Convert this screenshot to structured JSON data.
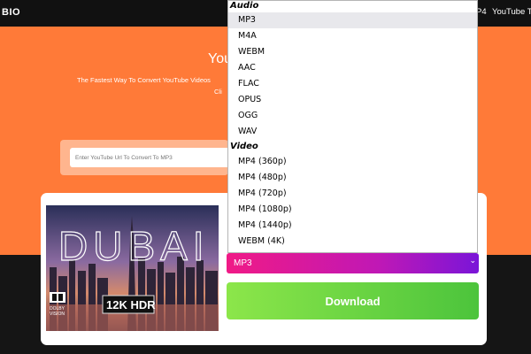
{
  "navbar": {
    "logo": "BIO",
    "links": [
      "P4",
      "YouTube To"
    ]
  },
  "hero": {
    "title": "You",
    "subtitle": "The Fastest Way To Convert YouTube Videos",
    "subtitle2": "Cli"
  },
  "url_input": {
    "placeholder": "Enter YouTube Url To Convert To MP3"
  },
  "thumbnail": {
    "title_text": "DUBAI",
    "badge_text": "12K HDR",
    "brand_line1": "DOLBY",
    "brand_line2": "VISION"
  },
  "format": {
    "selected": "MP3",
    "audio_label": "Audio",
    "audio_options": [
      "MP3",
      "M4A",
      "WEBM",
      "AAC",
      "FLAC",
      "OPUS",
      "OGG",
      "WAV"
    ],
    "video_label": "Video",
    "video_options": [
      "MP4 (360p)",
      "MP4 (480p)",
      "MP4 (720p)",
      "MP4 (1080p)",
      "MP4 (1440p)",
      "WEBM (4K)"
    ],
    "chevron_icon": "chevron-down-icon"
  },
  "download": {
    "label": "Download"
  },
  "colors": {
    "hero": "#ff7a38",
    "accent_gradient_start": "#f01a86",
    "accent_gradient_end": "#7a15d8",
    "download_start": "#8ce64a",
    "download_end": "#4cc43c"
  }
}
